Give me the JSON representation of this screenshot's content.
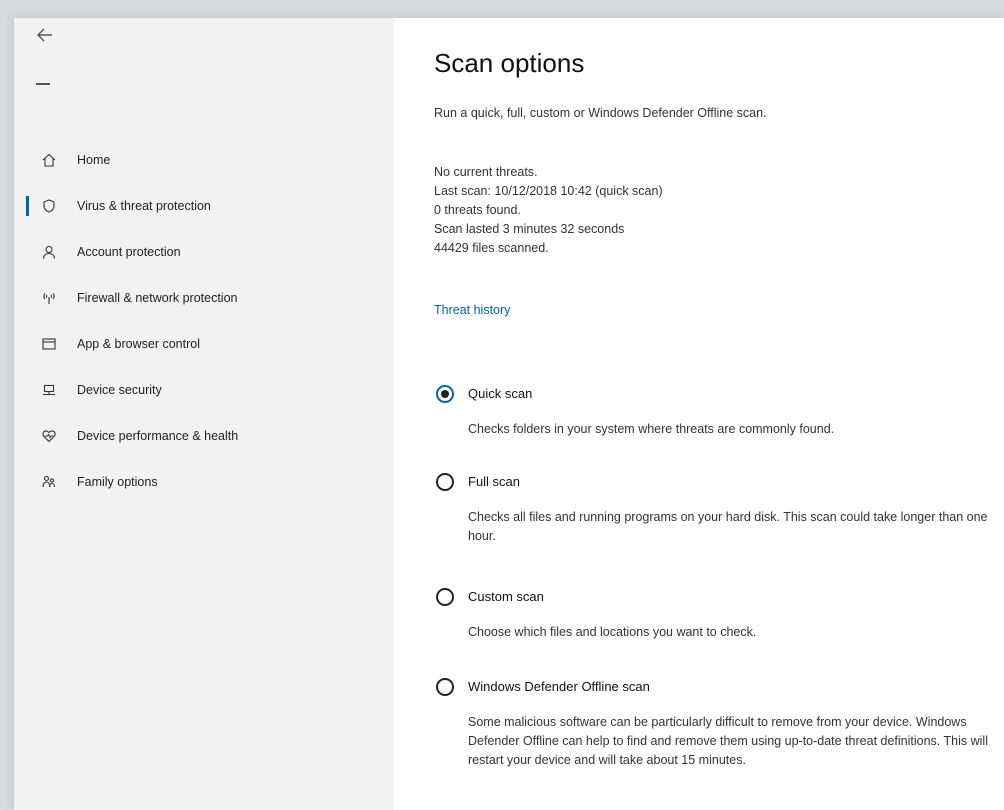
{
  "sidebar": {
    "items": [
      {
        "label": "Home",
        "icon": "home-icon"
      },
      {
        "label": "Virus & threat protection",
        "icon": "shield-icon",
        "active": true
      },
      {
        "label": "Account protection",
        "icon": "person-icon"
      },
      {
        "label": "Firewall & network protection",
        "icon": "wifi-antenna-icon"
      },
      {
        "label": "App & browser control",
        "icon": "browser-window-icon"
      },
      {
        "label": "Device security",
        "icon": "laptop-icon"
      },
      {
        "label": "Device performance & health",
        "icon": "heart-pulse-icon"
      },
      {
        "label": "Family options",
        "icon": "family-icon"
      }
    ]
  },
  "main": {
    "title": "Scan options",
    "subtitle": "Run a quick, full, custom or Windows Defender Offline scan.",
    "status_lines": [
      "No current threats.",
      "Last scan: 10/12/2018 10:42 (quick scan)",
      "0 threats found.",
      "Scan lasted 3 minutes 32 seconds",
      "44429 files scanned."
    ],
    "threat_history_link": "Threat history",
    "options": [
      {
        "label": "Quick scan",
        "checked": true,
        "description": "Checks folders in your system where threats are commonly found."
      },
      {
        "label": "Full scan",
        "checked": false,
        "description": "Checks all files and running programs on your hard disk. This scan could take longer than one hour."
      },
      {
        "label": "Custom scan",
        "checked": false,
        "description": "Choose which files and locations you want to check."
      },
      {
        "label": "Windows Defender Offline scan",
        "checked": false,
        "description": "Some malicious software can be particularly difficult to remove from your device. Windows Defender Offline can help to find and remove them using up-to-date threat definitions. This will restart your device and will take about 15 minutes."
      }
    ]
  },
  "colors": {
    "accent": "#0063b1",
    "sidebar_bg": "#f2f2f2"
  }
}
